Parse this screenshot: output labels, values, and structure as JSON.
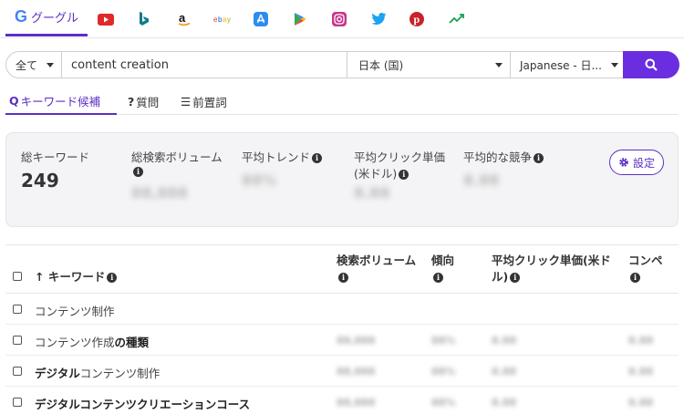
{
  "engines": {
    "active_label": "グーグル",
    "items": [
      {
        "icon": "google-icon"
      },
      {
        "icon": "youtube-icon",
        "color": "#e02a2a"
      },
      {
        "icon": "bing-icon",
        "color": "#0f7b8c"
      },
      {
        "icon": "amazon-icon",
        "color": "#111111"
      },
      {
        "icon": "ebay-icon",
        "text": "ebay"
      },
      {
        "icon": "app-store-icon",
        "color": "#2d8cf0"
      },
      {
        "icon": "google-play-icon"
      },
      {
        "icon": "instagram-icon",
        "color": "#c7368a"
      },
      {
        "icon": "twitter-icon",
        "color": "#1da1f2"
      },
      {
        "icon": "pinterest-icon",
        "color": "#c8232c"
      },
      {
        "icon": "trends-icon"
      }
    ]
  },
  "search": {
    "category": "全て",
    "query": "content creation",
    "country": "日本 (国)",
    "language": "Japanese - 日..."
  },
  "subtabs": [
    {
      "prefix": "Q",
      "label": "キーワード候補"
    },
    {
      "prefix": "?",
      "label": "質問"
    },
    {
      "prefix": "☰",
      "label": "前置詞"
    }
  ],
  "summary": {
    "total_keywords_label": "総キーワード",
    "total_keywords_value": "249",
    "search_volume_label": "総検索ボリューム",
    "search_volume_value": "88,888",
    "trend_label": "平均トレンド",
    "trend_value": "88%",
    "cpc_label_1": "平均クリック単価",
    "cpc_label_2": "(米ドル)",
    "cpc_value": "8.88",
    "competition_label": "平均的な競争",
    "competition_value": "8.88",
    "settings_label": "設定"
  },
  "table": {
    "headers": {
      "keyword": "↑ キーワード",
      "volume": "検索ボリューム",
      "trend": "傾向",
      "cpc_1": "平均クリック単価(米ド",
      "cpc_2": "ル)",
      "competition": "コンペ"
    },
    "rows": [
      {
        "pre": "コンテンツ制作",
        "bold": "",
        "volume": "",
        "trend": "",
        "cpc": "",
        "comp": ""
      },
      {
        "pre": "コンテンツ作成",
        "bold": "の種類",
        "volume": "88,888",
        "trend": "88%",
        "cpc": "8.88",
        "comp": "8.88"
      },
      {
        "pre": "",
        "bold": "デジタル",
        "post": "コンテンツ制作",
        "volume": "88,888",
        "trend": "88%",
        "cpc": "8.88",
        "comp": "8.88"
      },
      {
        "pre": "",
        "bold": "デジタルコンテンツクリエーションコース",
        "volume": "88,888",
        "trend": "88%",
        "cpc": "8.88",
        "comp": "8.88"
      }
    ]
  }
}
